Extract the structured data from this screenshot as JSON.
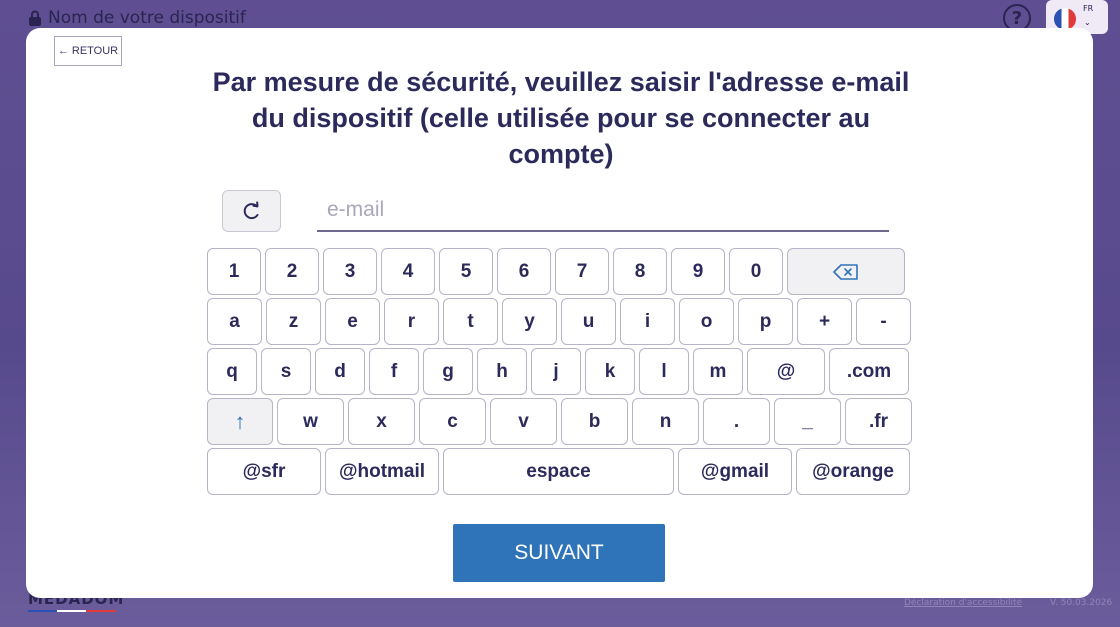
{
  "background": {
    "device_title": "Nom de votre dispositif",
    "language_code": "FR",
    "logo_text": "MEDADOM",
    "accessibility_link": "Déclaration d'accessibilité",
    "version": "V. 50.03.2026"
  },
  "modal": {
    "back_label": "RETOUR",
    "title": "Par mesure de sécurité, veuillez saisir l'adresse e-mail du dispositif (celle utilisée pour se connecter au compte)",
    "email_placeholder": "e-mail",
    "email_value": "",
    "next_label": "SUIVANT"
  },
  "keyboard": {
    "row1": [
      "1",
      "2",
      "3",
      "4",
      "5",
      "6",
      "7",
      "8",
      "9",
      "0"
    ],
    "row2": [
      "a",
      "z",
      "e",
      "r",
      "t",
      "y",
      "u",
      "i",
      "o",
      "p",
      "+",
      "-"
    ],
    "row3": [
      "q",
      "s",
      "d",
      "f",
      "g",
      "h",
      "j",
      "k",
      "l",
      "m",
      "@",
      ".com"
    ],
    "row4": [
      "w",
      "x",
      "c",
      "v",
      "b",
      "n",
      ".",
      "_",
      ".fr"
    ],
    "row5": [
      "@sfr",
      "@hotmail",
      "espace",
      "@gmail",
      "@orange"
    ]
  },
  "icons": {
    "lock": "lock-icon",
    "help": "help-icon",
    "flag": "french-flag-icon",
    "back": "arrow-left-icon",
    "reset": "refresh-icon",
    "backspace": "backspace-icon",
    "shift": "shift-arrow-icon"
  },
  "colors": {
    "background": "#5f4f92",
    "primary_button": "#2f73b8",
    "title_text": "#2c2a5a",
    "shift_arrow": "#2f73b8"
  }
}
